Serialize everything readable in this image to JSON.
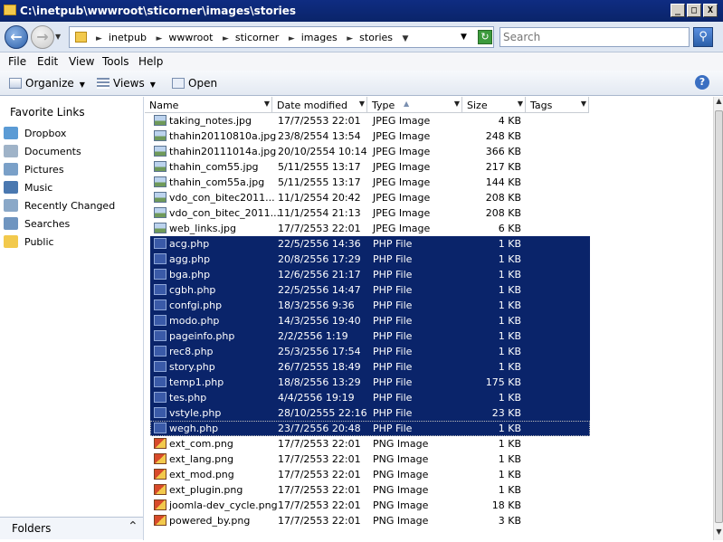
{
  "window": {
    "title": "C:\\inetpub\\wwwroot\\sticorner\\images\\stories",
    "minimize": "_",
    "maximize": "□",
    "close": "X"
  },
  "address": {
    "crumbs": [
      "inetpub",
      "wwwroot",
      "sticorner",
      "images",
      "stories"
    ],
    "search_placeholder": "Search"
  },
  "menu": [
    "File",
    "Edit",
    "View",
    "Tools",
    "Help"
  ],
  "toolbar": {
    "organize": "Organize",
    "views": "Views",
    "open": "Open",
    "help": "?"
  },
  "nav": {
    "header": "Favorite Links",
    "items": [
      "Dropbox",
      "Documents",
      "Pictures",
      "Music",
      "Recently Changed",
      "Searches",
      "Public"
    ],
    "folders_label": "Folders"
  },
  "columns": [
    "Name",
    "Date modified",
    "Type",
    "Size",
    "Tags"
  ],
  "files": [
    {
      "name": "taking_notes.jpg",
      "date": "17/7/2553 22:01",
      "type": "JPEG Image",
      "size": "4 KB",
      "kind": "img"
    },
    {
      "name": "thahin20110810a.jpg",
      "date": "23/8/2554 13:54",
      "type": "JPEG Image",
      "size": "248 KB",
      "kind": "img"
    },
    {
      "name": "thahin20111014a.jpg",
      "date": "20/10/2554 10:14",
      "type": "JPEG Image",
      "size": "366 KB",
      "kind": "img"
    },
    {
      "name": "thahin_com55.jpg",
      "date": "5/11/2555 13:17",
      "type": "JPEG Image",
      "size": "217 KB",
      "kind": "img"
    },
    {
      "name": "thahin_com55a.jpg",
      "date": "5/11/2555 13:17",
      "type": "JPEG Image",
      "size": "144 KB",
      "kind": "img"
    },
    {
      "name": "vdo_con_bitec2011...",
      "date": "11/1/2554 20:42",
      "type": "JPEG Image",
      "size": "208 KB",
      "kind": "img"
    },
    {
      "name": "vdo_con_bitec_2011...",
      "date": "11/1/2554 21:13",
      "type": "JPEG Image",
      "size": "208 KB",
      "kind": "img"
    },
    {
      "name": "web_links.jpg",
      "date": "17/7/2553 22:01",
      "type": "JPEG Image",
      "size": "6 KB",
      "kind": "img"
    },
    {
      "name": "acg.php",
      "date": "22/5/2556 14:36",
      "type": "PHP File",
      "size": "1 KB",
      "kind": "php",
      "selected": true
    },
    {
      "name": "agg.php",
      "date": "20/8/2556 17:29",
      "type": "PHP File",
      "size": "1 KB",
      "kind": "php",
      "selected": true
    },
    {
      "name": "bga.php",
      "date": "12/6/2556 21:17",
      "type": "PHP File",
      "size": "1 KB",
      "kind": "php",
      "selected": true
    },
    {
      "name": "cgbh.php",
      "date": "22/5/2556 14:47",
      "type": "PHP File",
      "size": "1 KB",
      "kind": "php",
      "selected": true
    },
    {
      "name": "confgi.php",
      "date": "18/3/2556 9:36",
      "type": "PHP File",
      "size": "1 KB",
      "kind": "php",
      "selected": true
    },
    {
      "name": "modo.php",
      "date": "14/3/2556 19:40",
      "type": "PHP File",
      "size": "1 KB",
      "kind": "php",
      "selected": true
    },
    {
      "name": "pageinfo.php",
      "date": "2/2/2556 1:19",
      "type": "PHP File",
      "size": "1 KB",
      "kind": "php",
      "selected": true
    },
    {
      "name": "rec8.php",
      "date": "25/3/2556 17:54",
      "type": "PHP File",
      "size": "1 KB",
      "kind": "php",
      "selected": true
    },
    {
      "name": "story.php",
      "date": "26/7/2555 18:49",
      "type": "PHP File",
      "size": "1 KB",
      "kind": "php",
      "selected": true
    },
    {
      "name": "temp1.php",
      "date": "18/8/2556 13:29",
      "type": "PHP File",
      "size": "175 KB",
      "kind": "php",
      "selected": true
    },
    {
      "name": "tes.php",
      "date": "4/4/2556 19:19",
      "type": "PHP File",
      "size": "1 KB",
      "kind": "php",
      "selected": true
    },
    {
      "name": "vstyle.php",
      "date": "28/10/2555 22:16",
      "type": "PHP File",
      "size": "23 KB",
      "kind": "php",
      "selected": true
    },
    {
      "name": "wegh.php",
      "date": "23/7/2556 20:48",
      "type": "PHP File",
      "size": "1 KB",
      "kind": "php",
      "selected": true,
      "focused": true
    },
    {
      "name": "ext_com.png",
      "date": "17/7/2553 22:01",
      "type": "PNG Image",
      "size": "1 KB",
      "kind": "png"
    },
    {
      "name": "ext_lang.png",
      "date": "17/7/2553 22:01",
      "type": "PNG Image",
      "size": "1 KB",
      "kind": "png"
    },
    {
      "name": "ext_mod.png",
      "date": "17/7/2553 22:01",
      "type": "PNG Image",
      "size": "1 KB",
      "kind": "png"
    },
    {
      "name": "ext_plugin.png",
      "date": "17/7/2553 22:01",
      "type": "PNG Image",
      "size": "1 KB",
      "kind": "png"
    },
    {
      "name": "joomla-dev_cycle.png",
      "date": "17/7/2553 22:01",
      "type": "PNG Image",
      "size": "18 KB",
      "kind": "png"
    },
    {
      "name": "powered_by.png",
      "date": "17/7/2553 22:01",
      "type": "PNG Image",
      "size": "3 KB",
      "kind": "png"
    }
  ],
  "colors": {
    "selection": "#0a246a",
    "titlebar": "#0a246a"
  }
}
